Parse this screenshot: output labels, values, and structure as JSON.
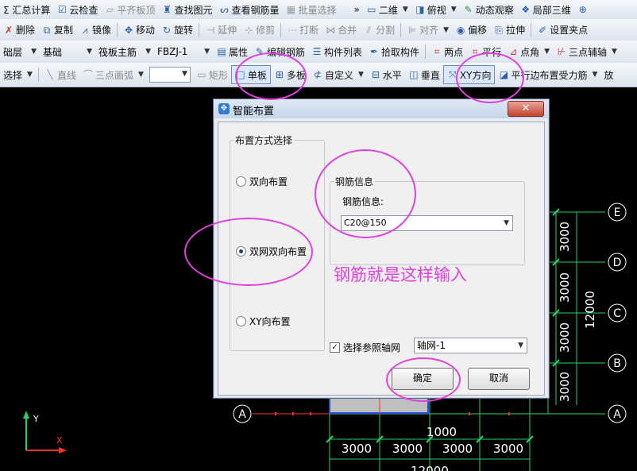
{
  "toolbar1": {
    "summary_calc": "Σ 汇总计算",
    "cloud_check": "云检查",
    "flat_slab_top": "平齐板顶",
    "find_element": "查找图元",
    "view_rebar_qty": "查看钢筋量",
    "batch_select": "批量选择",
    "more": "»",
    "view_2d": "二维",
    "view_top": "俯视",
    "dynamic_observe": "动态观察",
    "partial_3d": "局部三维"
  },
  "toolbar2": {
    "delete": "删除",
    "copy": "复制",
    "mirror": "镜像",
    "move": "移动",
    "rotate": "旋转",
    "extend": "延伸",
    "trim": "修剪",
    "break": "打断",
    "merge": "合并",
    "split": "分割",
    "align": "对齐",
    "offset": "偏移",
    "stretch": "拉伸",
    "set_grip": "设置夹点"
  },
  "toolbar3": {
    "layer": "础层",
    "category": "基础",
    "element_type": "筏板主筋",
    "element_name": "FBZJ-1",
    "properties": "属性",
    "edit_rebar": "编辑钢筋",
    "element_list": "构件列表",
    "pick_element": "拾取构件",
    "two_points": "两点",
    "parallel": "平行",
    "point_angle": "点角",
    "three_point_aux": "三点辅轴"
  },
  "toolbar4": {
    "select": "选择",
    "line": "直线",
    "three_point_arc": "三点画弧",
    "rectangle": "矩形",
    "single_slab": "单板",
    "multi_slab": "多板",
    "custom": "自定义",
    "horizontal": "水平",
    "vertical": "垂直",
    "xy_direction": "XY方向",
    "parallel_edge": "平行边布置受力筋",
    "place": "放"
  },
  "dialog": {
    "title": "智能布置",
    "close_glyph": "✕",
    "layout_group_title": "布置方式选择",
    "option_bidirectional": "双向布置",
    "option_double_net": "双网双向布置",
    "option_xy": "XY向布置",
    "selected_option": "option_double_net",
    "rebar_group_title": "钢筋信息",
    "rebar_label": "钢筋信息:",
    "rebar_value": "C20@150",
    "ref_grid_label": "选择参照轴网",
    "ref_grid_checked": true,
    "grid_value": "轴网-1",
    "ok": "确定",
    "cancel": "取消"
  },
  "annotation": "钢筋就是这样输入",
  "canvas": {
    "axis_labels": [
      "E",
      "D",
      "C",
      "B",
      "A",
      "A"
    ],
    "vertical_dims": [
      "3000",
      "3000",
      "3000",
      "3000"
    ],
    "vertical_total": "12000",
    "horizontal_dims": [
      "3000",
      "3000",
      "3000",
      "3000"
    ],
    "dim_1000": "1000",
    "horizontal_total": "12000",
    "y_axis": "Y",
    "x_axis": "X"
  },
  "colors": {
    "annotation": "#e040e0",
    "grid_green": "#25d366",
    "grid_red": "#ff3030",
    "background": "#000000"
  }
}
